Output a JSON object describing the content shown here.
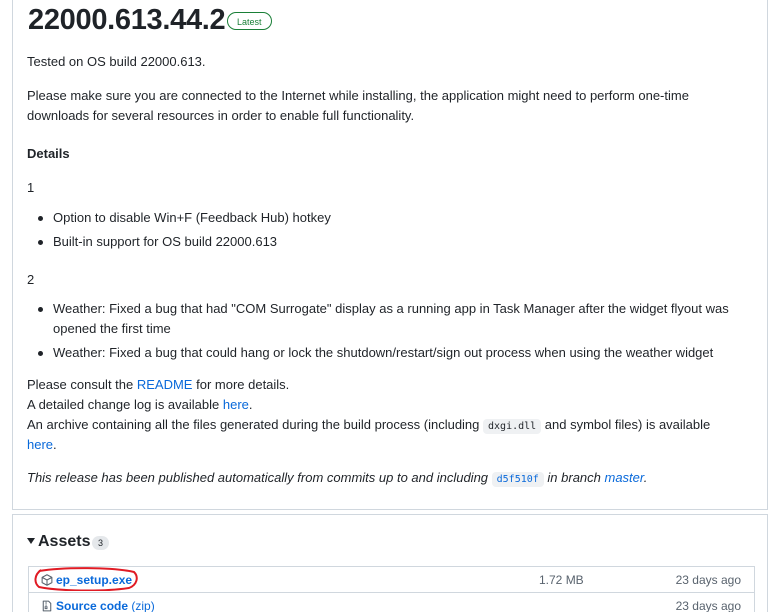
{
  "release": {
    "title": "22000.613.44.2",
    "badge": "Latest",
    "tested": "Tested on OS build 22000.613.",
    "notice_line1": "Please make sure you are connected to the Internet while installing, the application might need to perform one-time",
    "notice_line2": "downloads for several resources in order to enable full functionality.",
    "details_heading": "Details",
    "section1_heading": "1",
    "section1_items": [
      "Option to disable Win+F (Feedback Hub) hotkey",
      "Built-in support for OS build 22000.613"
    ],
    "section2_heading": "2",
    "section2_items": [
      {
        "line1": "Weather: Fixed a bug that had \"COM Surrogate\" display as a running app in Task Manager after the widget flyout was",
        "line2": "opened the first time"
      },
      {
        "line1": "Weather: Fixed a bug that could hang or lock the shutdown/restart/sign out process when using the weather widget"
      }
    ],
    "consult_prefix": "Please consult the ",
    "consult_link": "README",
    "consult_suffix": " for more details.",
    "changelog_prefix": "A detailed change log is available ",
    "changelog_link": "here",
    "changelog_suffix": ".",
    "archive_prefix": "An archive containing all the files generated during the build process (including ",
    "archive_code": "dxgi.dll",
    "archive_suffix": " and symbol files) is available",
    "archive_link": "here",
    "archive_end": ".",
    "published_prefix": "This release has been published automatically from commits up to and including ",
    "published_commit": "d5f510f",
    "published_middle": " in branch ",
    "published_branch": "master",
    "published_end": "."
  },
  "assets": {
    "heading": "Assets",
    "count": "3",
    "rows": [
      {
        "icon": "package-icon",
        "name": "ep_setup.exe",
        "size": "1.72 MB",
        "date": "23 days ago"
      },
      {
        "icon": "file-zip-icon",
        "name": "Source code",
        "extra": "(zip)",
        "size": "",
        "date": "23 days ago"
      }
    ]
  },
  "colors": {
    "link": "#0969da",
    "latest_badge": "#1a7f37",
    "annotation": "#e01b24"
  }
}
